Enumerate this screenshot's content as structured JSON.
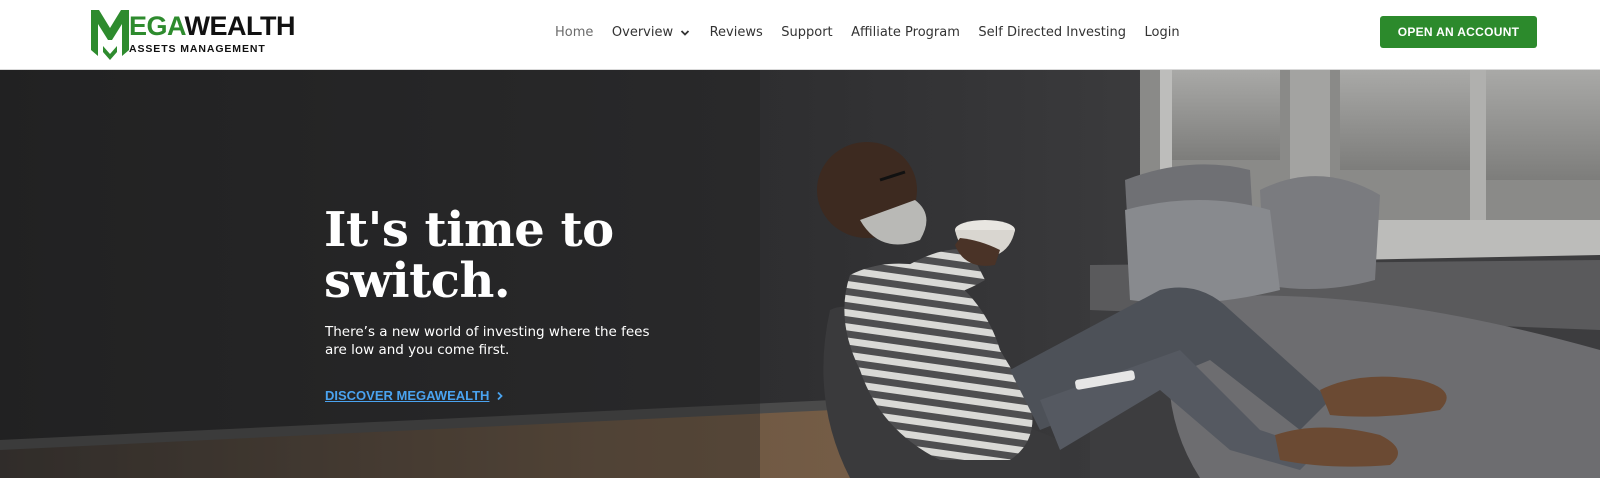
{
  "logo": {
    "word_green": "EGA",
    "word_black": "WEALTH",
    "tagline": "ASSETS MANAGEMENT"
  },
  "nav": {
    "items": [
      {
        "label": "Home",
        "active": true
      },
      {
        "label": "Overview",
        "has_dropdown": true
      },
      {
        "label": "Reviews"
      },
      {
        "label": "Support"
      },
      {
        "label": "Affiliate Program"
      },
      {
        "label": "Self Directed Investing"
      },
      {
        "label": "Login"
      }
    ]
  },
  "header": {
    "cta_label": "OPEN AN ACCOUNT"
  },
  "hero": {
    "title": "It's time to switch.",
    "subtitle": "There’s a new world of investing where the fees are low and you come first.",
    "link_label": "DISCOVER MEGAWEALTH"
  },
  "colors": {
    "brand_green": "#2c8a2c",
    "link_blue": "#4aa3f0",
    "hero_dark": "#2b2b2c"
  }
}
